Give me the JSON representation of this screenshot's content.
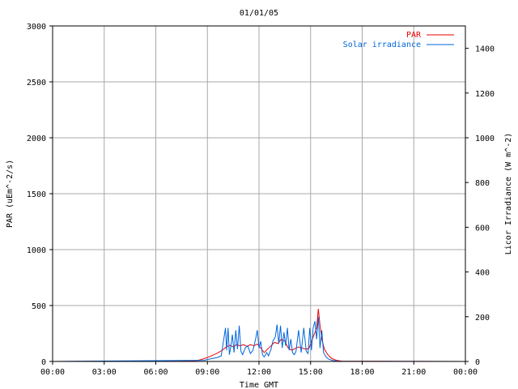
{
  "chart_data": {
    "type": "line",
    "title": "01/01/05",
    "xlabel": "Time GMT",
    "ylabel_left": "PAR (uEm^-2/s)",
    "ylabel_right": "Licor Irradiance (W m^-2)",
    "x_ticks": [
      "00:00",
      "03:00",
      "06:00",
      "09:00",
      "12:00",
      "15:00",
      "18:00",
      "21:00",
      "00:00"
    ],
    "x_unit": "hours GMT",
    "xlim": [
      0,
      24
    ],
    "ylim_left": [
      0,
      3000
    ],
    "y_ticks_left": [
      0,
      500,
      1000,
      1500,
      2000,
      2500,
      3000
    ],
    "ylim_right": [
      0,
      1500
    ],
    "y_ticks_right": [
      0,
      200,
      400,
      600,
      800,
      1000,
      1200,
      1400
    ],
    "grid": true,
    "legend_position": "top-right",
    "series": [
      {
        "name": "PAR",
        "axis": "left",
        "color": "#ee0000",
        "x": [
          0,
          8.3,
          8.6,
          9.0,
          9.3,
          9.6,
          9.9,
          10.1,
          10.3,
          10.5,
          10.7,
          10.9,
          11.1,
          11.3,
          11.5,
          11.7,
          11.9,
          12.1,
          12.3,
          12.5,
          12.7,
          12.9,
          13.1,
          13.3,
          13.5,
          13.7,
          13.9,
          14.1,
          14.3,
          14.5,
          14.7,
          14.9,
          15.1,
          15.25,
          15.35,
          15.45,
          15.55,
          15.65,
          15.8,
          16.0,
          16.2,
          16.5,
          16.8,
          24
        ],
        "y": [
          0,
          5,
          15,
          35,
          55,
          75,
          105,
          130,
          145,
          130,
          150,
          140,
          150,
          135,
          150,
          140,
          155,
          120,
          80,
          110,
          140,
          170,
          160,
          200,
          180,
          120,
          100,
          115,
          130,
          120,
          110,
          115,
          200,
          260,
          300,
          470,
          320,
          200,
          110,
          60,
          30,
          10,
          3,
          0
        ]
      },
      {
        "name": "Solar irradiance",
        "axis": "right",
        "color": "#0066dd",
        "x": [
          0,
          8.8,
          9.2,
          9.6,
          9.8,
          10.05,
          10.12,
          10.2,
          10.28,
          10.35,
          10.45,
          10.55,
          10.65,
          10.75,
          10.85,
          10.95,
          11.05,
          11.2,
          11.35,
          11.5,
          11.65,
          11.8,
          11.9,
          12.0,
          12.1,
          12.2,
          12.3,
          12.45,
          12.55,
          12.7,
          12.8,
          12.95,
          13.05,
          13.15,
          13.25,
          13.35,
          13.45,
          13.55,
          13.65,
          13.75,
          13.85,
          13.95,
          14.05,
          14.15,
          14.3,
          14.45,
          14.6,
          14.75,
          14.85,
          14.95,
          15.05,
          15.15,
          15.25,
          15.35,
          15.45,
          15.55,
          15.65,
          15.75,
          15.9,
          16.05,
          16.3,
          16.6,
          24
        ],
        "y": [
          0,
          5,
          12,
          18,
          25,
          150,
          50,
          150,
          30,
          60,
          120,
          40,
          140,
          55,
          160,
          45,
          30,
          60,
          70,
          35,
          50,
          100,
          140,
          60,
          90,
          30,
          20,
          40,
          25,
          55,
          90,
          110,
          165,
          80,
          160,
          60,
          130,
          70,
          150,
          50,
          100,
          40,
          30,
          45,
          140,
          40,
          150,
          45,
          35,
          150,
          50,
          150,
          180,
          100,
          200,
          60,
          140,
          40,
          20,
          10,
          4,
          1,
          0
        ]
      }
    ]
  }
}
